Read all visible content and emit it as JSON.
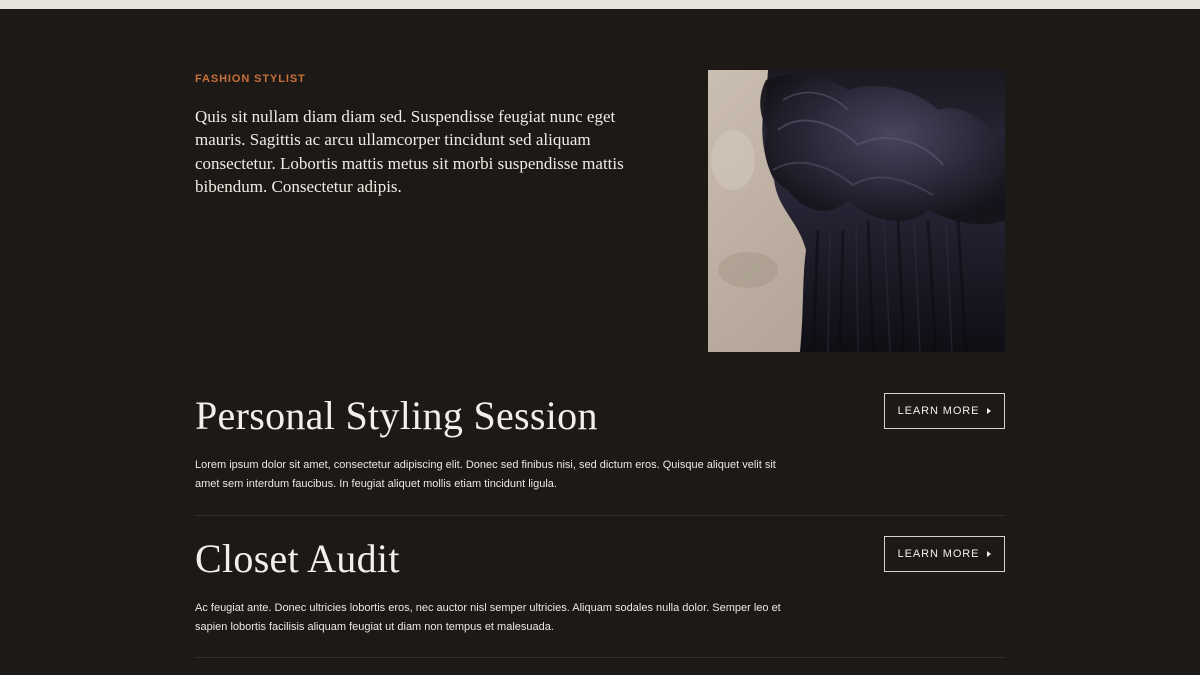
{
  "intro": {
    "eyebrow": "FASHION STYLIST",
    "text": "Quis sit nullam diam diam sed. Suspendisse feugiat nunc eget mauris. Sagittis ac arcu ullamcorper tincidunt sed aliquam consectetur. Lobortis mattis metus sit morbi suspendisse mattis bibendum. Consectetur adipis."
  },
  "services": [
    {
      "title": "Personal Styling Session",
      "description": "Lorem ipsum dolor sit amet, consectetur adipiscing elit. Donec sed finibus nisi, sed dictum eros. Quisque aliquet velit sit amet sem interdum faucibus. In feugiat aliquet mollis etiam tincidunt ligula.",
      "button_label": "LEARN MORE"
    },
    {
      "title": "Closet Audit",
      "description": "Ac feugiat ante. Donec ultricies lobortis eros, nec auctor nisl semper ultricies. Aliquam sodales nulla dolor. Semper leo et sapien lobortis facilisis aliquam feugiat ut diam non tempus et malesuada.",
      "button_label": "LEARN MORE"
    }
  ],
  "colors": {
    "background": "#1d1917",
    "accent": "#c8703a",
    "text": "#f4efe8"
  }
}
